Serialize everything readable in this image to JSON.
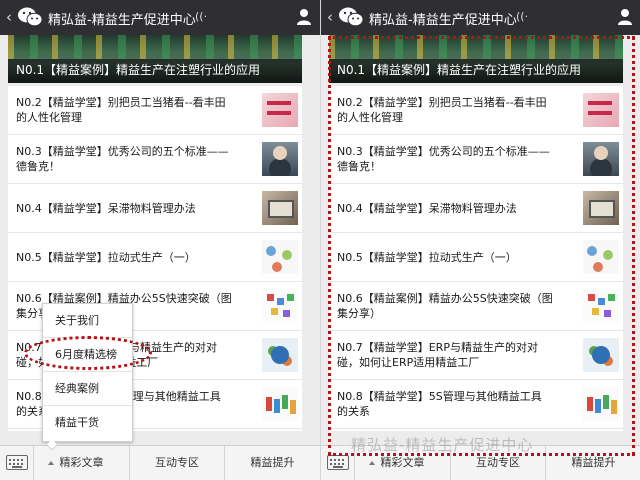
{
  "header": {
    "back_glyph": "‹",
    "title": "精弘益-精益生产促进中心",
    "audio_glyph": "((·",
    "icons": [
      "wechat-icon",
      "user-icon"
    ],
    "bar_color": "#2e2e33"
  },
  "banner": {
    "title": "N0.1【精益案例】精益生产在注塑行业的应用"
  },
  "articles_left": [
    {
      "lines": [
        "N0.2【精益学堂】别把员工当猪看--看丰田",
        "的人性化管理"
      ],
      "thumb": "pink-text-thumbnail"
    },
    {
      "lines": [
        "N0.3【精益学堂】优秀公司的五个标准——",
        "德鲁克！"
      ],
      "thumb": "portrait-thumbnail"
    },
    {
      "lines": [
        "N0.4【精益学堂】呆滞物料管理办法"
      ],
      "thumb": "warehouse-thumbnail"
    },
    {
      "lines": [
        "N0.5【精益学堂】拉动式生产（一）"
      ],
      "thumb": "diagram-thumbnail"
    },
    {
      "lines": [
        "N0.6【精益案例】精益办公5S快速突破（图",
        "集分享）"
      ],
      "thumb": "5s-thumbnail"
    },
    {
      "lines": [
        "N0.7【精益学堂】ERP与精益生产的对对",
        "碰，如何让ERP适用精益工厂"
      ],
      "thumb": "erp-thumbnail"
    },
    {
      "lines": [
        "N0.8【精益学堂】5S管理与其他精益工具",
        "的关系"
      ],
      "thumb": "tools-thumbnail"
    }
  ],
  "articles_right": [
    {
      "lines": [
        "N0.2【精益学堂】别把员工当猪看--看丰田",
        "的人性化管理"
      ],
      "thumb": "pink-text-thumbnail"
    },
    {
      "lines": [
        "N0.3【精益学堂】优秀公司的五个标准——",
        "德鲁克！"
      ],
      "thumb": "portrait-thumbnail"
    },
    {
      "lines": [
        "N0.4【精益学堂】呆滞物料管理办法"
      ],
      "thumb": "warehouse-thumbnail"
    },
    {
      "lines": [
        "N0.5【精益学堂】拉动式生产（一）"
      ],
      "thumb": "diagram-thumbnail"
    },
    {
      "lines": [
        "N0.6【精益案例】精益办公5S快速突破（图",
        "集分享）"
      ],
      "thumb": "5s-thumbnail"
    },
    {
      "lines": [
        "N0.7【精益学堂】ERP与精益生产的对对",
        "碰，如何让ERP适用精益工厂"
      ],
      "thumb": "erp-thumbnail"
    },
    {
      "lines": [
        "N0.8【精益学堂】5S管理与其他精益工具",
        "的关系"
      ],
      "thumb": "tools-thumbnail"
    }
  ],
  "menu": {
    "items": [
      "精彩文章",
      "互动专区",
      "精益提升"
    ],
    "keyboard_icon": "keyboard-icon"
  },
  "popup": {
    "items": [
      "关于我们",
      "6月度精选榜",
      "经典案例",
      "精益干货"
    ],
    "highlighted": "6月度精选榜",
    "highlight_color": "#b01417"
  },
  "watermark": "精弘益-精益生产促进中心"
}
